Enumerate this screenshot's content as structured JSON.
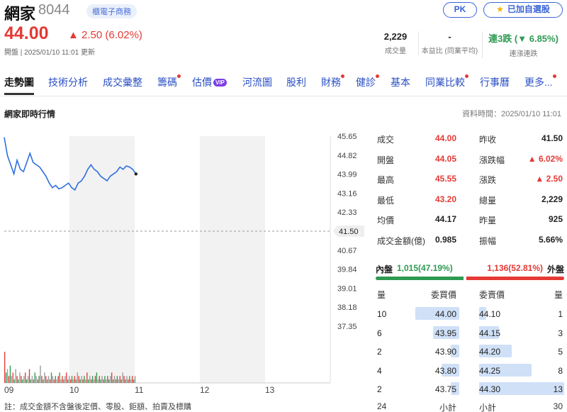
{
  "stock": {
    "name": "網家",
    "code": "8044",
    "tag": "櫃電子商務",
    "price": "44.00",
    "change": "▲ 2.50 (6.02%)",
    "open_info": "開盤 | 2025/01/10 11:01 更新"
  },
  "buttons": {
    "pk": "PK",
    "watchlist": "已加自選股"
  },
  "stats": {
    "volume": {
      "value": "2,229",
      "label": "成交量"
    },
    "pe": {
      "value": "-",
      "label": "本益比 (同業平均)"
    },
    "streak": {
      "value": "連3跌 (▼ 6.85%)",
      "label": "連漲連跌"
    }
  },
  "nav": [
    {
      "label": "走勢圖",
      "active": true
    },
    {
      "label": "技術分析"
    },
    {
      "label": "成交彙整"
    },
    {
      "label": "籌碼",
      "dot": true
    },
    {
      "label": "估價",
      "vip": "VIP"
    },
    {
      "label": "河流圖"
    },
    {
      "label": "股利"
    },
    {
      "label": "財務",
      "dot": true
    },
    {
      "label": "健診",
      "dot": true
    },
    {
      "label": "基本"
    },
    {
      "label": "同業比較",
      "dot": true
    },
    {
      "label": "行事曆"
    },
    {
      "label": "更多...",
      "dot": true
    }
  ],
  "section": {
    "title": "網家即時行情",
    "data_time": "資料時間：2025/01/10 11:01"
  },
  "chart_data": {
    "type": "line",
    "x_ticks": [
      "09",
      "10",
      "11",
      "12",
      "13"
    ],
    "y_ticks": [
      "45.65",
      "44.82",
      "43.99",
      "43.16",
      "42.33",
      "41.50",
      "40.67",
      "39.84",
      "39.01",
      "38.18",
      "37.35"
    ],
    "ylim": [
      37.35,
      45.65
    ],
    "reference_price": "41.50",
    "price_series": [
      45.6,
      44.8,
      44.4,
      44.0,
      44.6,
      44.2,
      44.1,
      44.5,
      44.9,
      44.5,
      44.4,
      44.3,
      44.1,
      43.9,
      43.6,
      43.4,
      43.5,
      43.35,
      43.4,
      43.5,
      43.6,
      43.4,
      43.3,
      43.6,
      43.7,
      43.9,
      44.2,
      44.4,
      44.2,
      44.1,
      43.9,
      43.8,
      43.7,
      43.9,
      44.0,
      44.1,
      44.3,
      44.2,
      44.35,
      44.3,
      44.2,
      44.0
    ],
    "volume_series": [
      9,
      3,
      4,
      2,
      5,
      2,
      3,
      1,
      4,
      2,
      1,
      3,
      2,
      1,
      2,
      3,
      1,
      2,
      4,
      1,
      2,
      1,
      3,
      2,
      1,
      2,
      5,
      2,
      1,
      3,
      2,
      1,
      2,
      1,
      3,
      2,
      1,
      2,
      1,
      2,
      3,
      1,
      2,
      1,
      2,
      3,
      1,
      2,
      1,
      2,
      1,
      2,
      1,
      3,
      2,
      1,
      2,
      1,
      2,
      1,
      3,
      1,
      2,
      1,
      2,
      1,
      2,
      3,
      1,
      2,
      1,
      2,
      1,
      2,
      1,
      2,
      1,
      2,
      3,
      1,
      2,
      1,
      2,
      1,
      2,
      1,
      3,
      2,
      1,
      2,
      1,
      2,
      1,
      2,
      1,
      2
    ]
  },
  "quote": [
    {
      "l1": "成交",
      "v1": "44.00",
      "c1": "red",
      "l2": "昨收",
      "v2": "41.50",
      "c2": "black"
    },
    {
      "l1": "開盤",
      "v1": "44.05",
      "c1": "red",
      "l2": "漲跌幅",
      "v2": "▲ 6.02%",
      "c2": "red"
    },
    {
      "l1": "最高",
      "v1": "45.55",
      "c1": "red",
      "l2": "漲跌",
      "v2": "▲ 2.50",
      "c2": "red"
    },
    {
      "l1": "最低",
      "v1": "43.20",
      "c1": "red",
      "l2": "總量",
      "v2": "2,229",
      "c2": "black"
    },
    {
      "l1": "均價",
      "v1": "44.17",
      "c1": "black",
      "l2": "昨量",
      "v2": "925",
      "c2": "black"
    },
    {
      "l1": "成交金額(億)",
      "v1": "0.985",
      "c1": "black",
      "l2": "振幅",
      "v2": "5.66%",
      "c2": "black"
    }
  ],
  "inout": {
    "in_label": "內盤",
    "in_value": "1,015(47.19%)",
    "in_pct": 47.19,
    "out_value": "1,136(52.81%)",
    "out_label": "外盤",
    "out_pct": 52.81
  },
  "orderbook": {
    "headers": {
      "qty_buy": "量",
      "bid": "委買價",
      "ask": "委賣價",
      "qty_sell": "量"
    },
    "rows": [
      {
        "bid_qty": "10",
        "bid": "44.00",
        "ask": "44.10",
        "ask_qty": "1",
        "bid_frac": 1.0,
        "ask_frac": 0.08
      },
      {
        "bid_qty": "6",
        "bid": "43.95",
        "ask": "44.15",
        "ask_qty": "3",
        "bid_frac": 0.6,
        "ask_frac": 0.23
      },
      {
        "bid_qty": "2",
        "bid": "43.90",
        "ask": "44.20",
        "ask_qty": "5",
        "bid_frac": 0.2,
        "ask_frac": 0.38
      },
      {
        "bid_qty": "4",
        "bid": "43.80",
        "ask": "44.25",
        "ask_qty": "8",
        "bid_frac": 0.4,
        "ask_frac": 0.62
      },
      {
        "bid_qty": "2",
        "bid": "43.75",
        "ask": "44.30",
        "ask_qty": "13",
        "bid_frac": 0.2,
        "ask_frac": 1.0
      }
    ],
    "footer": {
      "bid_total": "24",
      "bid_label": "小計",
      "ask_label": "小計",
      "ask_total": "30"
    }
  },
  "footnote": "註：成交金額不含盤後定價、零股、鉅額、拍賣及標購"
}
